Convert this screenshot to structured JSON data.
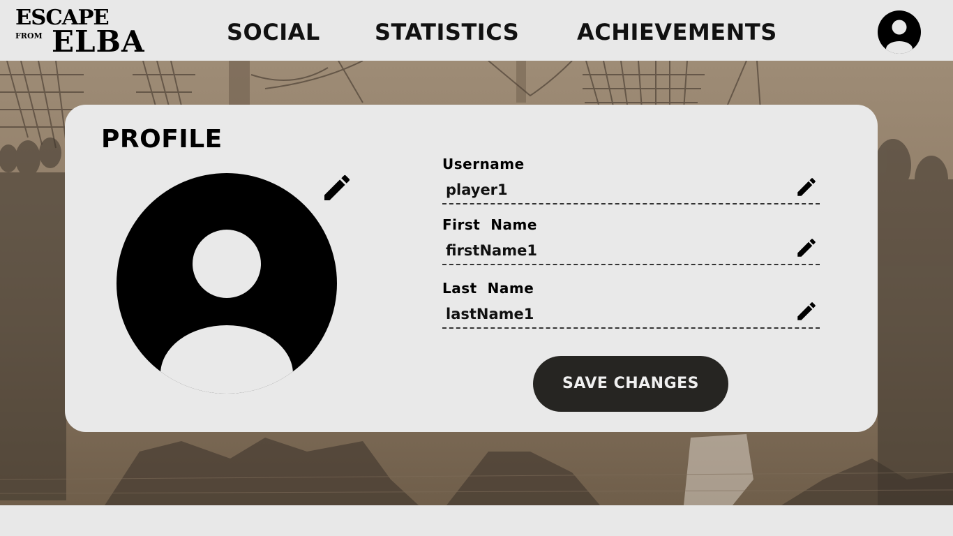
{
  "brand": {
    "line1": "ESCAPE",
    "from": "FROM",
    "line2": "ELBA"
  },
  "nav": {
    "social": "SOCIAL",
    "statistics": "STATISTICS",
    "achievements": "ACHIEVEMENTS",
    "account_icon": "user-circle-icon"
  },
  "profile": {
    "title": "PROFILE",
    "avatar_icon": "user-circle-icon",
    "edit_icon": "pencil-icon",
    "fields": [
      {
        "label": "Username",
        "value": "player1"
      },
      {
        "label": "First  Name",
        "value": "firstName1"
      },
      {
        "label": "Last  Name",
        "value": "lastName1"
      }
    ],
    "save_label": "SAVE CHANGES"
  },
  "colors": {
    "card_bg": "#e9e9e9",
    "button_bg": "#262522",
    "button_text": "#f0f0f0",
    "scene_tone": "#8a7762"
  }
}
